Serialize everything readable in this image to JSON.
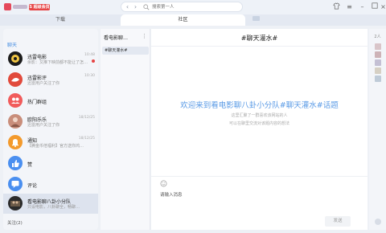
{
  "window": {
    "vip_badge": "S 超级会员",
    "search_placeholder": "搜索第一人"
  },
  "tabs": [
    {
      "label": "下载"
    },
    {
      "label": "社区"
    }
  ],
  "left": {
    "header": "聊天",
    "conversations": [
      {
        "title": "迅雷电影",
        "subtitle": "余影：又推下映前都不能让了怎…",
        "time": "10:48",
        "unread": true,
        "avatar_color": "#1c1c1c"
      },
      {
        "title": "迅雷影评",
        "subtitle": "迅雷用户关注了你",
        "time": "10:30",
        "unread": false,
        "avatar_color": "#e14a3c"
      },
      {
        "title": "热门群组",
        "subtitle": "",
        "time": "",
        "unread": false,
        "avatar_color": "#f15b5b"
      },
      {
        "title": "欧阳乐乐",
        "subtitle": "迅雷用户关注了你",
        "time": "18/12/25",
        "unread": false,
        "avatar_color": "#c98e7b"
      },
      {
        "title": "通知",
        "subtitle": "【腾金币倍福利】官方送你鸿…",
        "time": "18/12/25",
        "unread": false,
        "avatar_color": "#f39a2d"
      },
      {
        "title": "赞",
        "subtitle": "",
        "time": "",
        "unread": false,
        "avatar_color": "#4a8ff0"
      },
      {
        "title": "评论",
        "subtitle": "",
        "time": "",
        "unread": false,
        "avatar_color": "#4a8ff0"
      },
      {
        "title": "看电影聊八卦小分队",
        "subtitle": "只设电影，八卦聊全，畅聊…",
        "time": "",
        "unread": false,
        "avatar_color": "#2b2b2b"
      }
    ],
    "follow_label": "关注(2)"
  },
  "middle": {
    "title": "看电影聊…",
    "menu_glyph": "⋮",
    "topic": "#聊天灌水#"
  },
  "chat": {
    "title": "#聊天灌水#",
    "welcome": "欢迎来到看电影聊八卦小分队#聊天灌水#话题",
    "sub1": "这里汇聚了一群喜欢该网站的人",
    "sub2": "可以在聊里交流对该题内容的想法",
    "input_placeholder": "请输入消息",
    "send_label": "发送"
  },
  "rail": {
    "count": "2人",
    "avatars": [
      "#d9c5c9",
      "#cdb3b7",
      "#c4c0d4",
      "#d6d0c4",
      "#bfcbd8"
    ]
  },
  "colors": {
    "accent": "#5b9be6",
    "unread": "#e64545",
    "active_row": "#dde3ee"
  }
}
